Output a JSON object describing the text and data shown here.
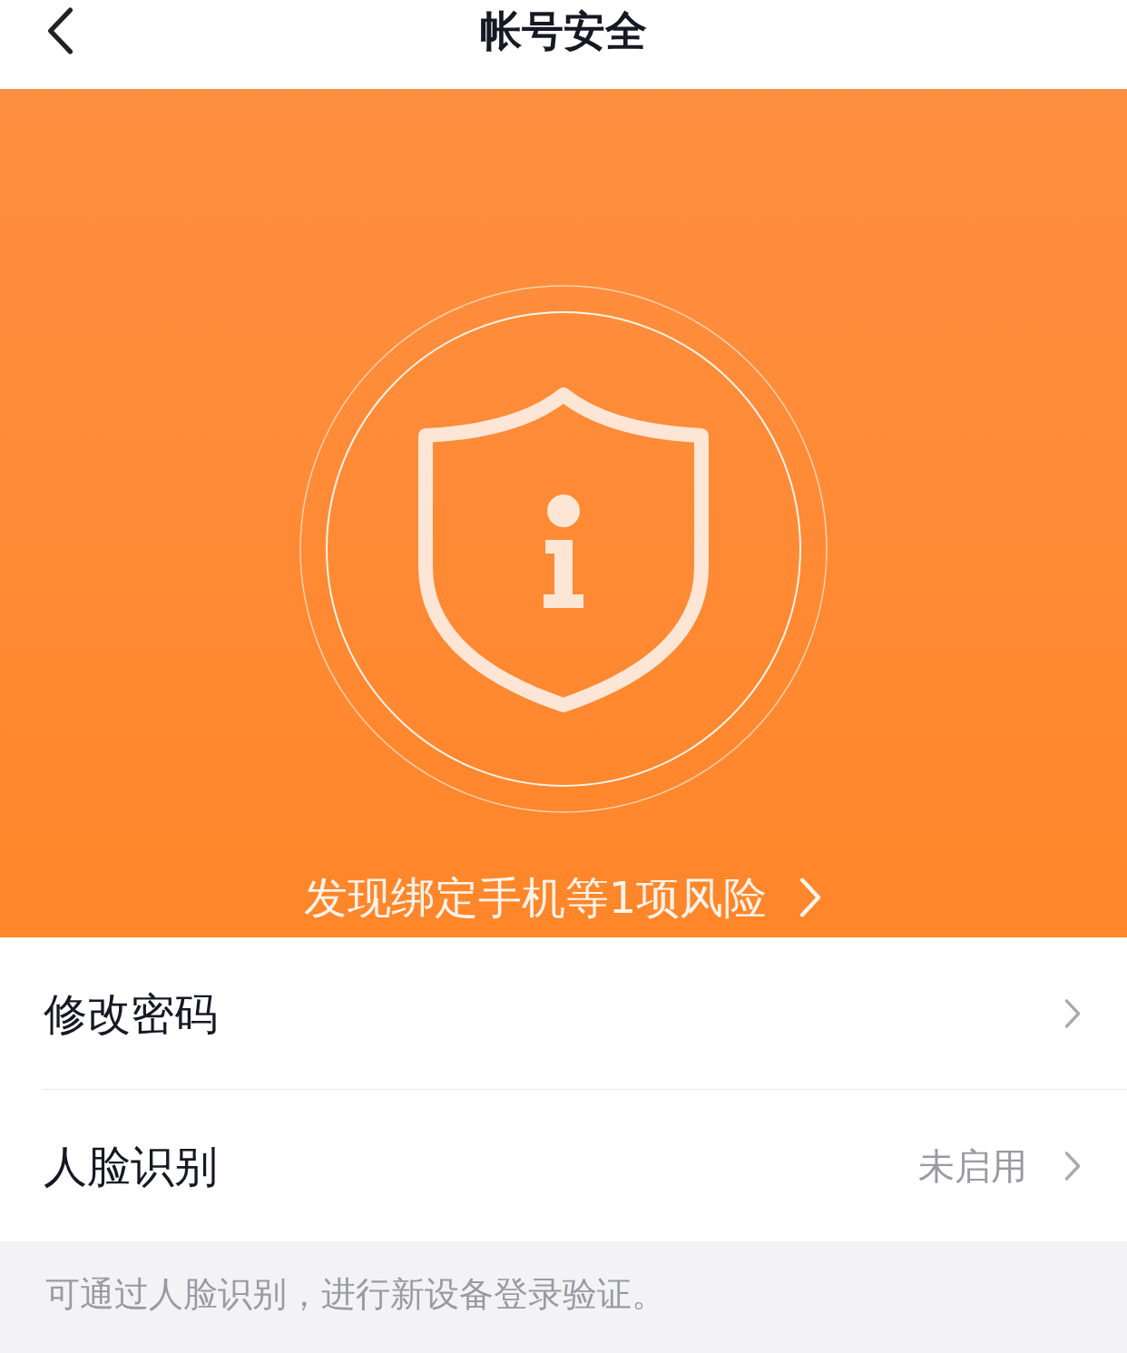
{
  "header": {
    "title": "帐号安全"
  },
  "banner": {
    "risk_text": "发现绑定手机等1项风险"
  },
  "items": [
    {
      "label": "修改密码"
    },
    {
      "label": "人脸识别",
      "value": "未启用"
    }
  ],
  "footer": {
    "note": "可通过人脸识别，进行新设备登录验证。"
  }
}
